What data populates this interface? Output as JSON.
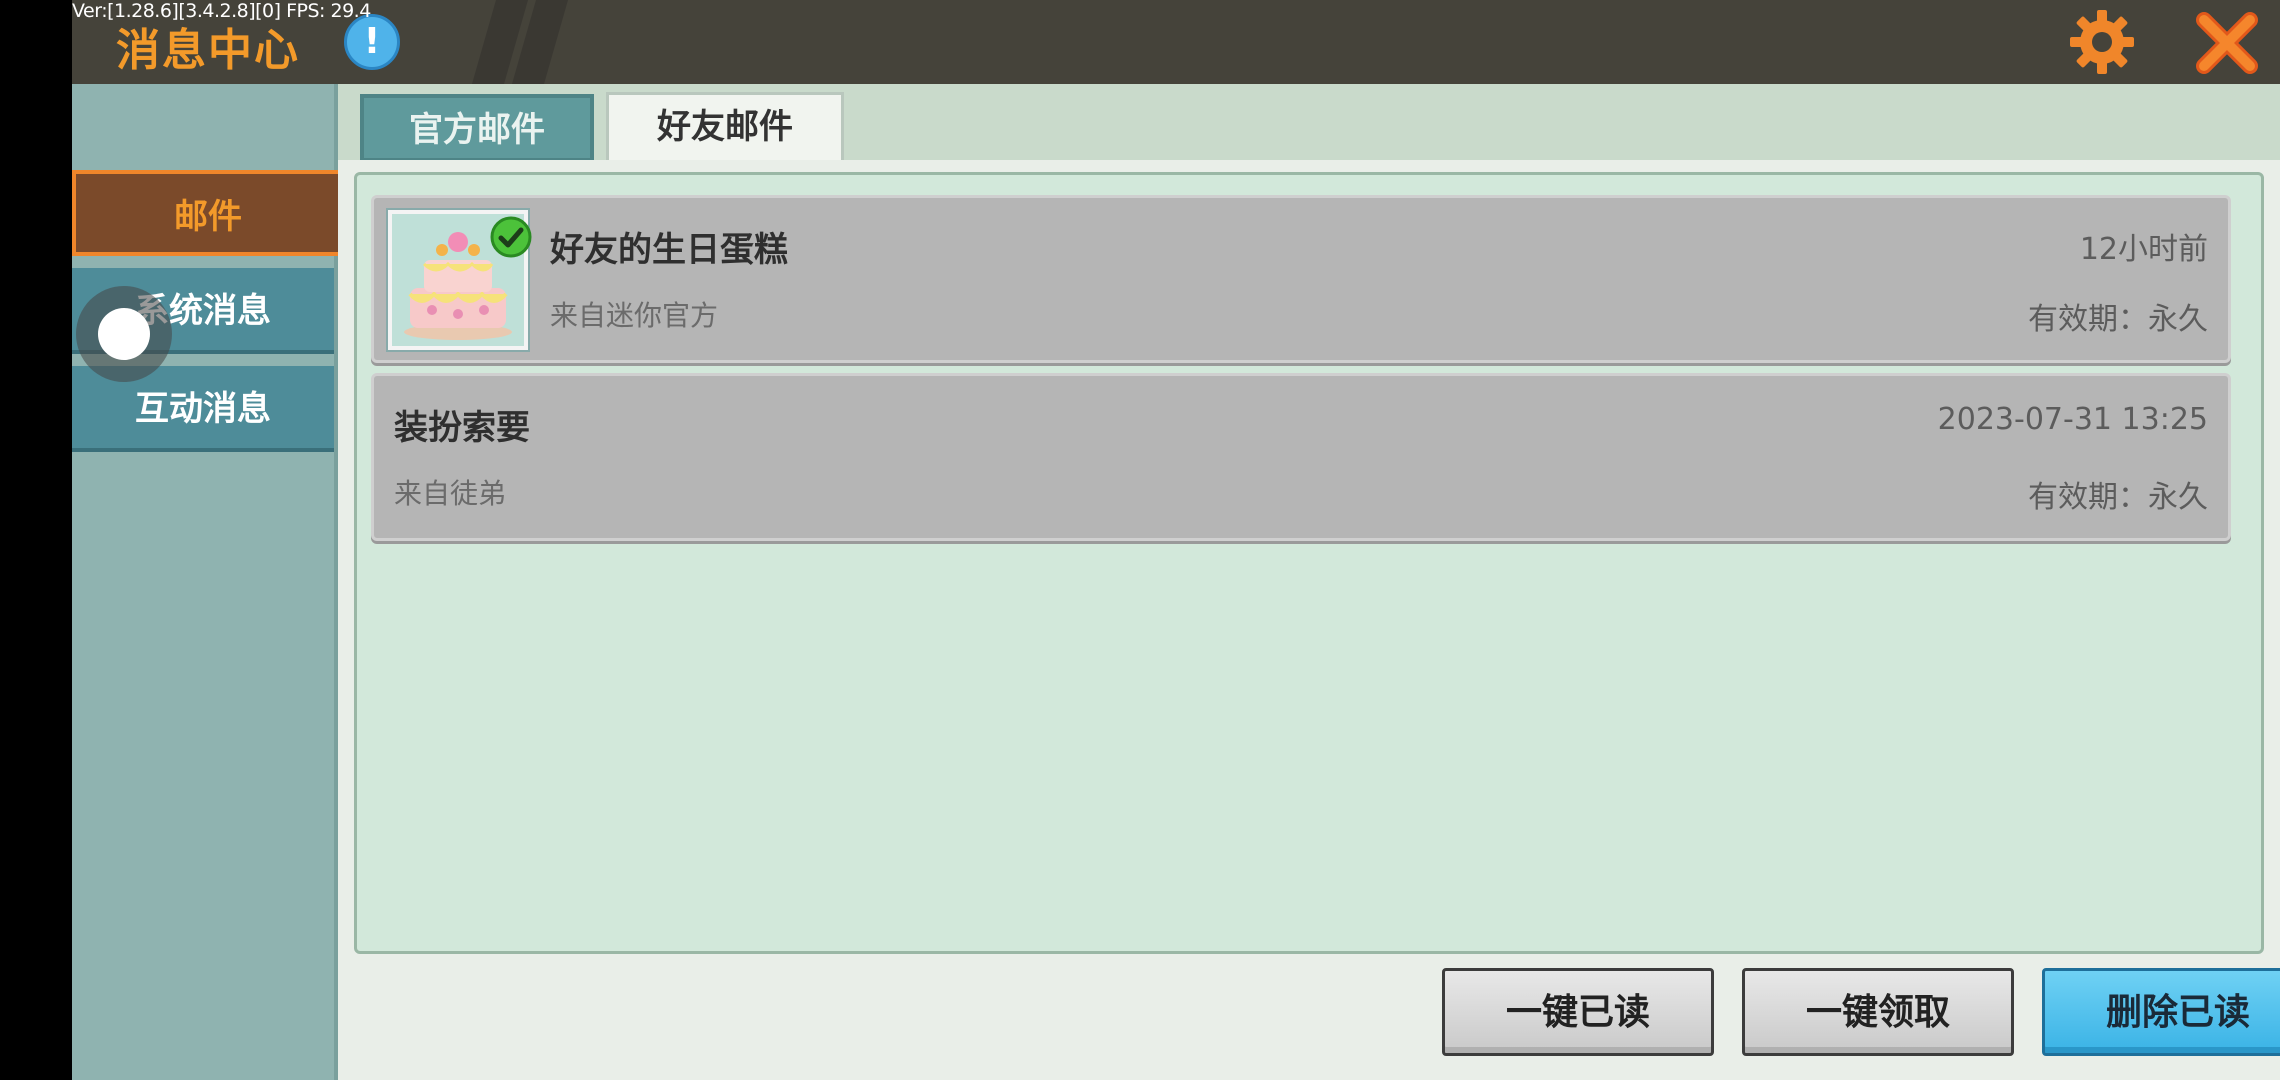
{
  "debug": {
    "version_text": "Ver:[1.28.6][3.4.2.8][0] FPS: 29.4"
  },
  "header": {
    "title": "消息中心",
    "info_icon": "exclamation-icon",
    "info_glyph": "!",
    "settings_icon": "gear-icon",
    "close_icon": "close-icon"
  },
  "sidebar": {
    "items": [
      {
        "label": "邮件",
        "selected": true
      },
      {
        "label": "系统消息",
        "selected": false
      },
      {
        "label": "互动消息",
        "selected": false
      }
    ]
  },
  "tabs": [
    {
      "label": "官方邮件",
      "selected": false
    },
    {
      "label": "好友邮件",
      "selected": true
    }
  ],
  "mails": [
    {
      "title": "好友的生日蛋糕",
      "from": "来自迷你官方",
      "time": "12小时前",
      "validity": "有效期：永久",
      "has_attachment": true,
      "attachment_icon": "birthday-cake-icon",
      "claimed": true
    },
    {
      "title": "装扮索要",
      "from": "来自徒弟",
      "time": "2023-07-31 13:25",
      "validity": "有效期：永久",
      "has_attachment": false
    }
  ],
  "actions": {
    "read_all": "一键已读",
    "claim_all": "一键领取",
    "delete_read": "删除已读"
  },
  "colors": {
    "accent_orange": "#f39a2a",
    "titlebar": "#45433a",
    "sidebar": "#8fb3b0",
    "panel": "#d2e8da",
    "delete_button": "#3ab3e6"
  }
}
